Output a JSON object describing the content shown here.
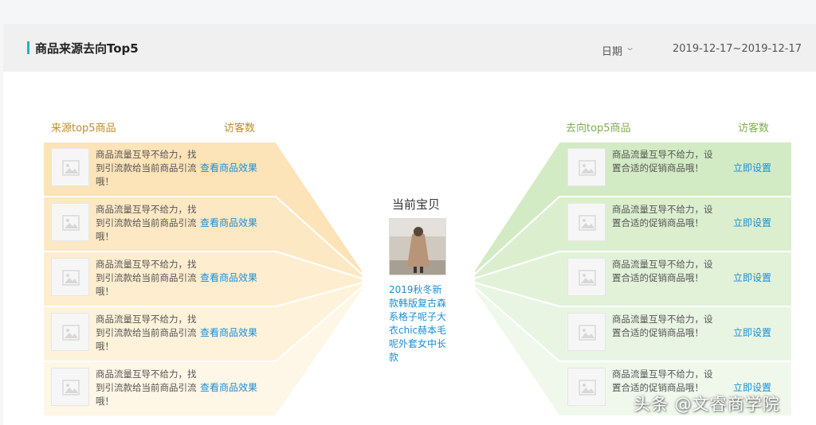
{
  "header": {
    "title": "商品来源去向Top5",
    "date_label": "日期",
    "date_range": "2019-12-17~2019-12-17"
  },
  "source": {
    "title": "来源top5商品",
    "visitors_label": "访客数",
    "items": [
      {
        "text": "商品流量互导不给力，找到引流款给当前商品引流哦！",
        "link": "查看商品效果"
      },
      {
        "text": "商品流量互导不给力，找到引流款给当前商品引流哦！",
        "link": "查看商品效果"
      },
      {
        "text": "商品流量互导不给力，找到引流款给当前商品引流哦！",
        "link": "查看商品效果"
      },
      {
        "text": "商品流量互导不给力，找到引流款给当前商品引流哦！",
        "link": "查看商品效果"
      },
      {
        "text": "商品流量互导不给力，找到引流款给当前商品引流哦！",
        "link": "查看商品效果"
      }
    ]
  },
  "target": {
    "title": "去向top5商品",
    "visitors_label": "访客数",
    "items": [
      {
        "text": "商品流量互导不给力，设置合适的促销商品哦！",
        "link": "立即设置"
      },
      {
        "text": "商品流量互导不给力，设置合适的促销商品哦！",
        "link": "立即设置"
      },
      {
        "text": "商品流量互导不给力，设置合适的促销商品哦！",
        "link": "立即设置"
      },
      {
        "text": "商品流量互导不给力，设置合适的促销商品哦！",
        "link": "立即设置"
      },
      {
        "text": "商品流量互导不给力，设置合适的促销商品哦！",
        "link": "立即设置"
      }
    ]
  },
  "current": {
    "label": "当前宝贝",
    "product_name": "2019秋冬新款韩版复古森系格子呢子大衣chic赫本毛呢外套女中长款"
  },
  "watermark": "头条 @文睿商学院",
  "colors": {
    "accent": "#1fb3c8",
    "source_title": "#c08a2c",
    "target_title": "#7fae4b",
    "link": "#1a8fd6",
    "source_bands": [
      "#fde3b8",
      "#fde8c4",
      "#feedcf",
      "#fef2da",
      "#fef6e6"
    ],
    "target_bands": [
      "#d3ebc4",
      "#dbefcf",
      "#e2f2d9",
      "#e9f5e3",
      "#f0f8ec"
    ]
  },
  "icons": {
    "thumbnail": "image-placeholder-icon",
    "dropdown": "chevron-down-icon"
  }
}
